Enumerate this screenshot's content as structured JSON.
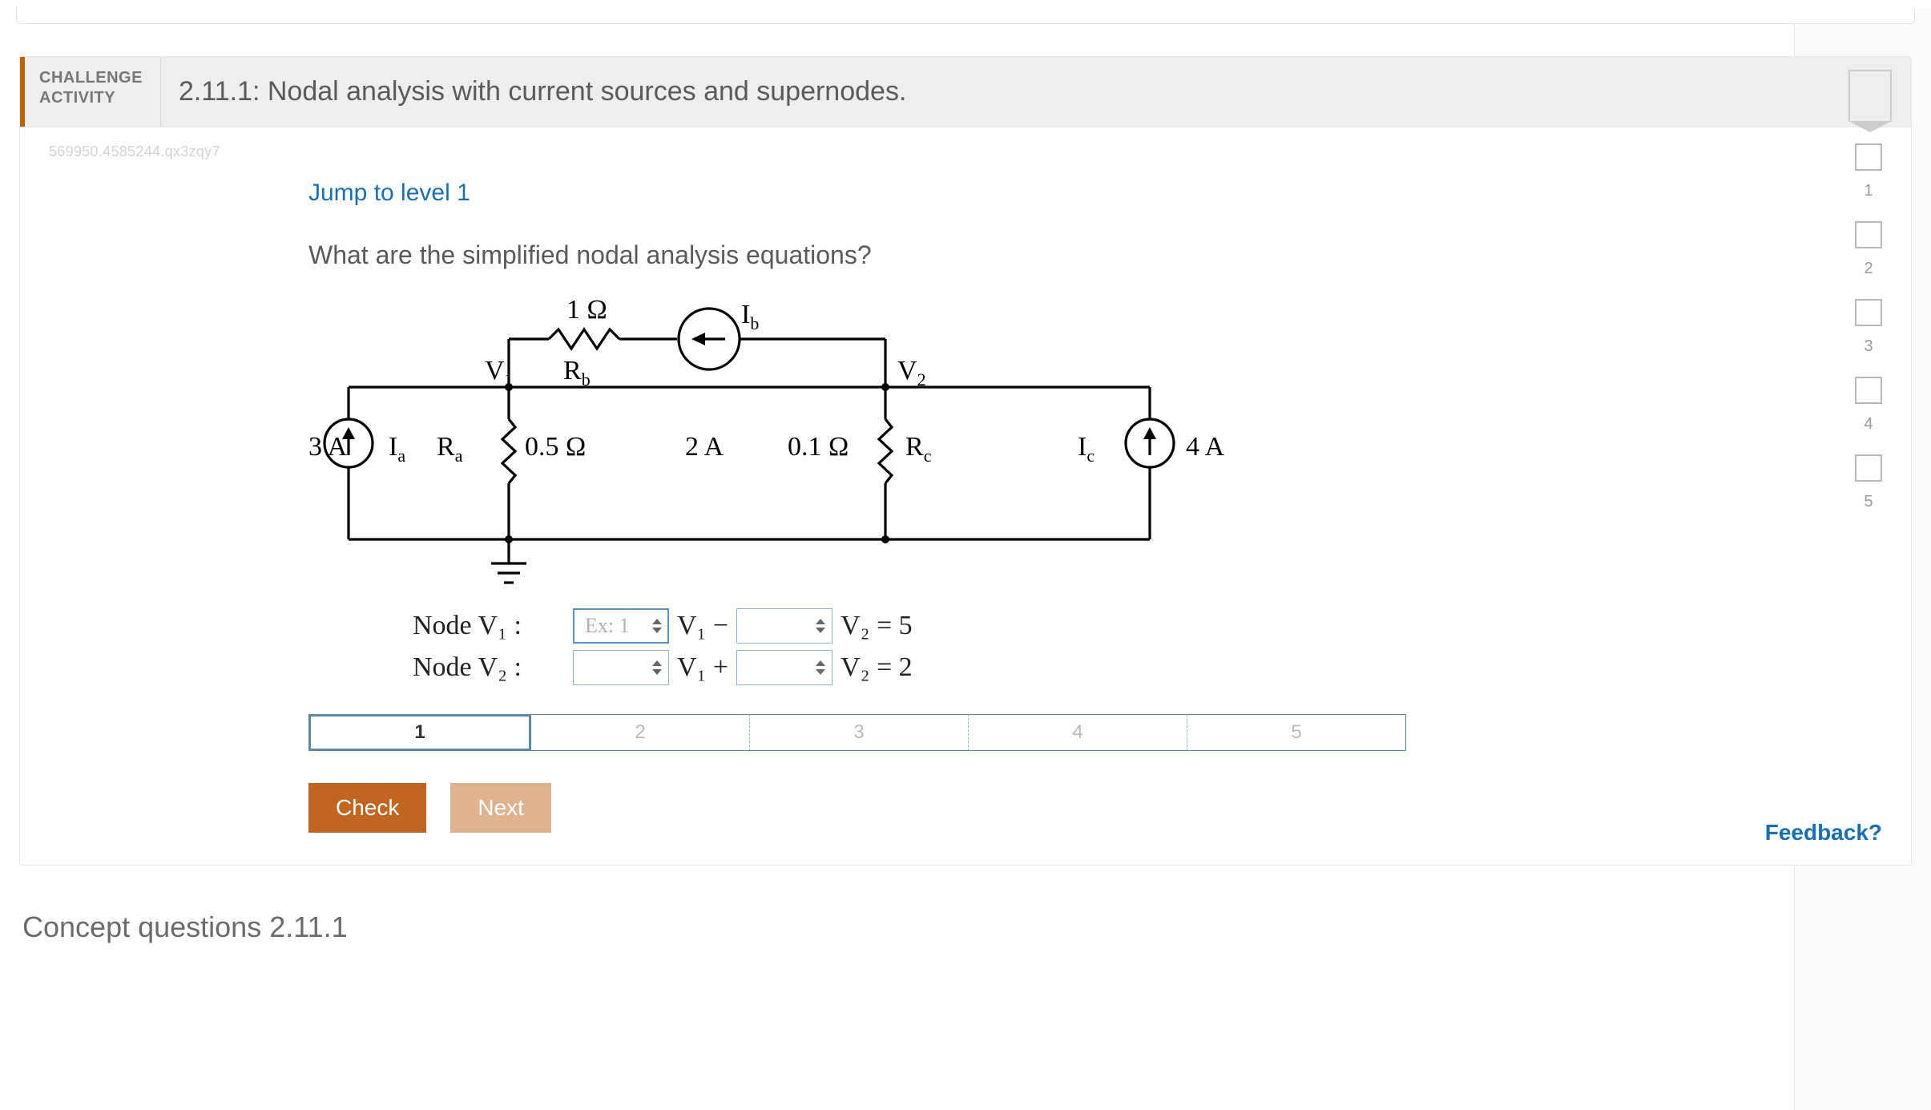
{
  "header": {
    "tag_line1": "CHALLENGE",
    "tag_line2": "ACTIVITY",
    "title": "2.11.1: Nodal analysis with current sources and supernodes."
  },
  "hash": "569950.4585244.qx3zqy7",
  "jump_link": "Jump to level 1",
  "prompt": "What are the simplified nodal analysis equations?",
  "circuit": {
    "resistor_top_value": "1 Ω",
    "V1": "V₁",
    "V2": "V₂",
    "Rb": "R_b",
    "Ib": "I_b",
    "src_left": "3 A",
    "Ia": "I_a",
    "Ra": "R_a",
    "Ra_val": "0.5 Ω",
    "mid_src": "2 A",
    "Rc_val": "0.1 Ω",
    "Rc": "R_c",
    "Ic": "I_c",
    "src_right": "4 A"
  },
  "equations": {
    "row1": {
      "label": "Node V₁ :",
      "input1_placeholder": "Ex: 1",
      "mid1": " V₁ −",
      "mid2": " V₂ = 5"
    },
    "row2": {
      "label": "Node V₂ :",
      "mid1": " V₁ +",
      "mid2": " V₂ = 2"
    }
  },
  "steps": [
    "1",
    "2",
    "3",
    "4",
    "5"
  ],
  "buttons": {
    "check": "Check",
    "next": "Next"
  },
  "feedback": "Feedback?",
  "levels": [
    "1",
    "2",
    "3",
    "4",
    "5"
  ],
  "concept_title": "Concept questions 2.11.1"
}
